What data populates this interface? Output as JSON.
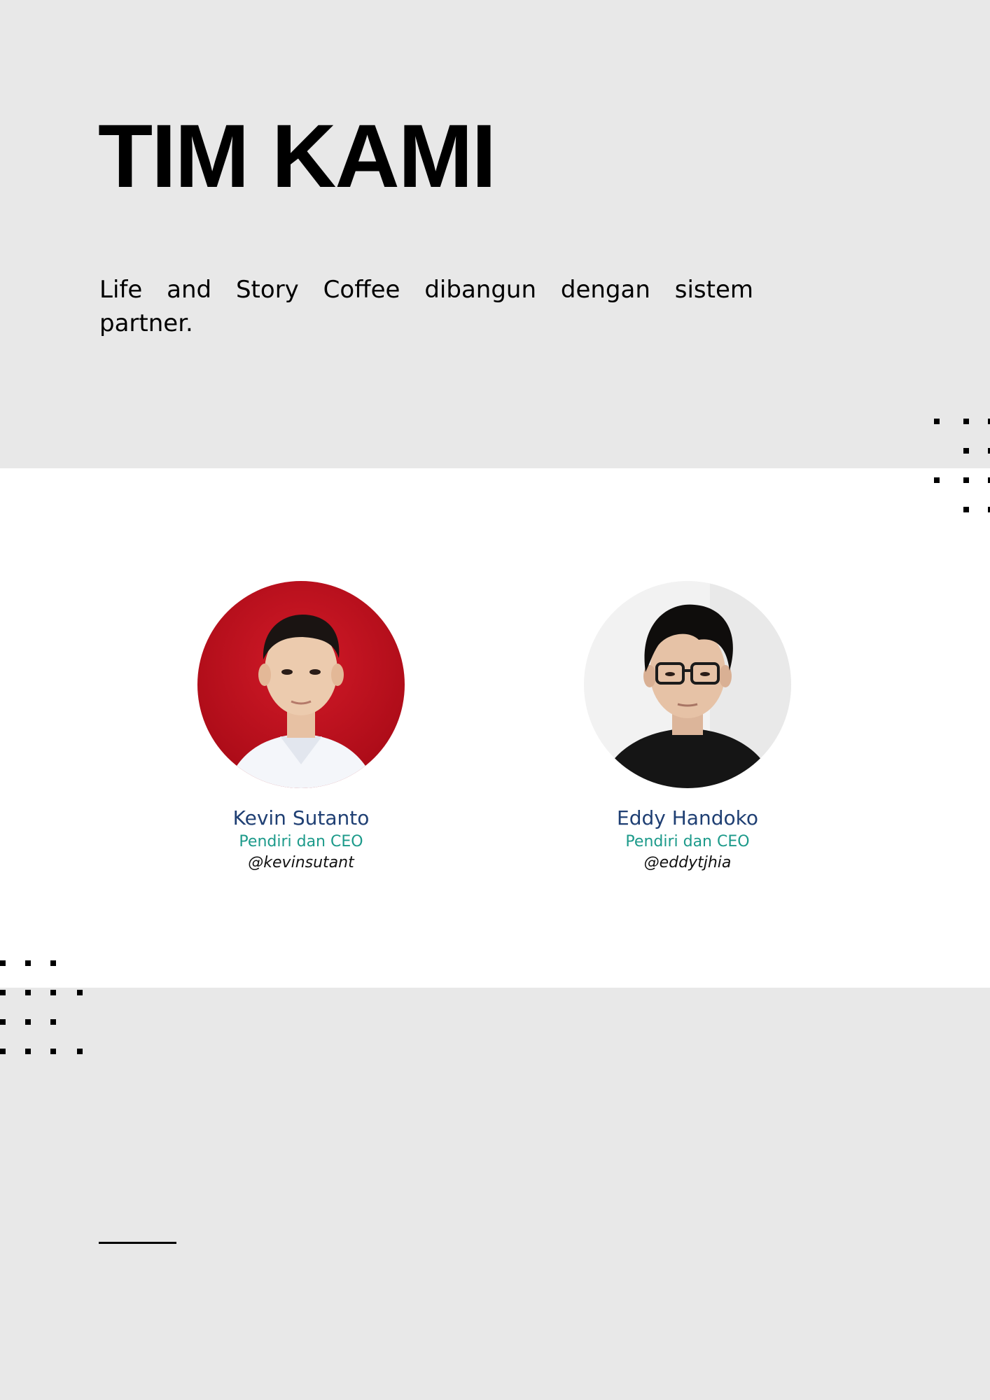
{
  "page": {
    "title": "TIM KAMI",
    "intro": "Life and Story Coffee dibangun dengan sistem partner."
  },
  "team": [
    {
      "name": "Kevin Sutanto",
      "role": "Pendiri dan CEO",
      "handle": "@kevinsutant",
      "photo_background": "#c0101e"
    },
    {
      "name": "Eddy Handoko",
      "role": "Pendiri dan CEO",
      "handle": "@eddytjhia",
      "photo_background": "#f2f2f2"
    }
  ],
  "colors": {
    "page_background": "#e8e8e8",
    "band_background": "#ffffff",
    "name": "#1f3f73",
    "role": "#1c9a8a",
    "text": "#000000"
  }
}
